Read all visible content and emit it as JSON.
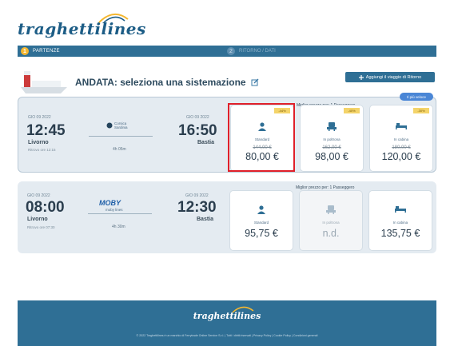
{
  "brand": {
    "logo_text": "traghettilines"
  },
  "steps": [
    {
      "number": "1",
      "label": "PARTENZE"
    },
    {
      "number": "2",
      "label": "RITORNO / DATI"
    }
  ],
  "heading": "ANDATA: seleziona una sistemazione",
  "add_button_label": "Aggiungi il viaggio di Ritorno",
  "top_tag": "Il più veloce",
  "trips": [
    {
      "dep_date": "GIO 09 2022",
      "dep_time": "12:45",
      "dep_port": "Livorno",
      "dep_note": "Ritrovo ore 12:15",
      "operator": "Corsica Sardinia",
      "duration": "4h 05m",
      "arr_date": "GIO 09 2022",
      "arr_time": "16:50",
      "arr_port": "Bastia",
      "best_price_label": "Miglior prezzo per: 1 Passeggero",
      "offers": [
        {
          "class": "Standard",
          "badge": "-44%",
          "old_price": "144,00 €",
          "price": "80,00 €",
          "icon": "person-icon"
        },
        {
          "class": "In poltrona",
          "badge": "-40%",
          "old_price": "162,00 €",
          "price": "98,00 €",
          "icon": "seat-icon"
        },
        {
          "class": "In cabina",
          "badge": "-30%",
          "old_price": "180,00 €",
          "price": "120,00 €",
          "icon": "bed-icon"
        }
      ]
    },
    {
      "dep_date": "GIO 09 2022",
      "dep_time": "08:00",
      "dep_port": "Livorno",
      "dep_note": "Ritrovo ore 07:30",
      "operator": "MOBY",
      "operator_sub": "moby lines",
      "duration": "4h 30m",
      "arr_date": "GIO 09 2022",
      "arr_time": "12:30",
      "arr_port": "Bastia",
      "best_price_label": "Miglior prezzo per: 1 Passeggero",
      "offers": [
        {
          "class": "Standard",
          "price": "95,75 €",
          "icon": "person-icon"
        },
        {
          "class": "In poltrona",
          "price": "n.d.",
          "icon": "seat-icon"
        },
        {
          "class": "In cabina",
          "price": "135,75 €",
          "icon": "bed-icon"
        }
      ]
    }
  ],
  "footer": {
    "logo_text": "traghettilines",
    "legal": "© 2022 Traghettilines è un marchio di Ferrytrade Online Service S.r.l. | Tutti i diritti riservati | Privacy Policy | Cookie Policy | Condizioni generali"
  },
  "colors": {
    "primary": "#2f6f95",
    "accent": "#f4b730",
    "highlight": "#e0202a"
  }
}
